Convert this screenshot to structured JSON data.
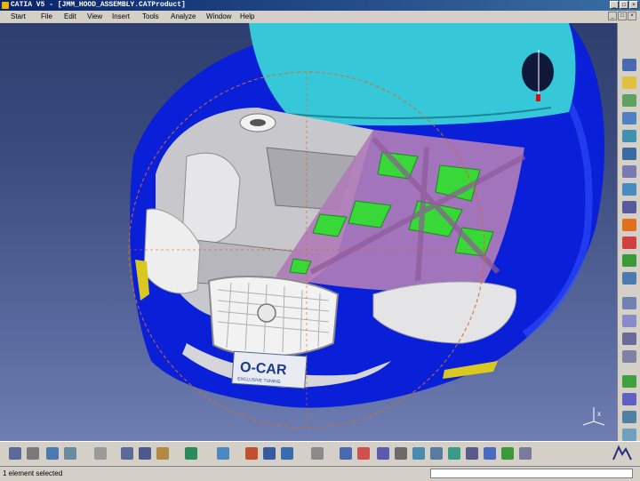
{
  "window": {
    "title": "CATIA V5 - [JMM_HOOD_ASSEMBLY.CATProduct]"
  },
  "menu": [
    {
      "label": "Start"
    },
    {
      "label": "File"
    },
    {
      "label": "Edit"
    },
    {
      "label": "View"
    },
    {
      "label": "Insert"
    },
    {
      "label": "Tools"
    },
    {
      "label": "Analyze"
    },
    {
      "label": "Window"
    },
    {
      "label": "Help"
    }
  ],
  "viewport": {
    "license_plate_text": "O-CAR",
    "license_plate_subtext": "EXCLUSIVE TUNING",
    "axis_label": "x"
  },
  "status": {
    "message": "1 element selected",
    "command_input": ""
  },
  "colors": {
    "car_body": "#0a1fd8",
    "windshield": "#36c8d8",
    "hood": "#b07cb8",
    "hood_ribs": "#38d838",
    "engine": "#c8c8cc",
    "compass_ring": "#d86a2a"
  },
  "icons": {
    "right_toolbar": [
      "select-arrow-icon",
      "insert-component-icon",
      "part-icon",
      "product-icon",
      "replace-icon",
      "graph-tree-icon",
      "generate-numbering-icon",
      "fast-multi-instantiation-icon",
      "bill-of-material-icon",
      "snap-icon",
      "explode-icon",
      "manipulate-icon",
      "constraint-icon",
      "fix-icon",
      "contact-icon",
      "offset-icon",
      "angle-icon",
      "update-icon",
      "measure-icon",
      "clash-icon",
      "sectioning-icon",
      "distance-icon",
      "3d-annotation-icon",
      "scenes-icon",
      "publish-icon",
      "dress-up-icon"
    ],
    "bottom_toolbar": [
      "new-icon",
      "open-icon",
      "save-icon",
      "print-icon",
      "cut-icon",
      "copy-icon",
      "paste-icon",
      "undo-icon",
      "redo-icon",
      "fly-icon",
      "fit-all-icon",
      "pan-icon",
      "rotate-icon",
      "zoom-in-icon",
      "zoom-out-icon",
      "normal-view-icon",
      "iso-view-icon",
      "shading-icon",
      "hide-show-icon",
      "swap-space-icon",
      "catia-logo-icon"
    ]
  }
}
